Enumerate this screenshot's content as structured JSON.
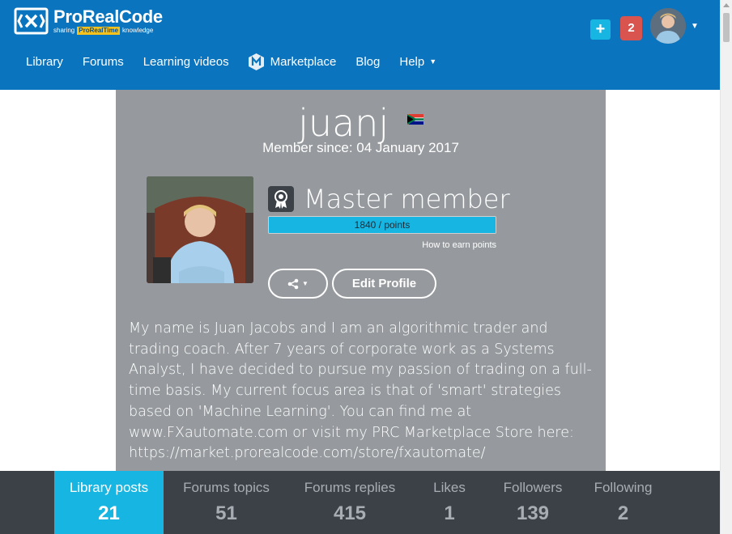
{
  "brand": {
    "name": "ProRealCode",
    "tagline_pre": "sharing",
    "tagline_highlight": "ProRealTime",
    "tagline_post": "knowledge",
    "color": "#0a74be",
    "accent": "#17b5e2"
  },
  "header": {
    "add_label": "+",
    "notifications_count": "2"
  },
  "nav": {
    "items": [
      {
        "label": "Library"
      },
      {
        "label": "Forums"
      },
      {
        "label": "Learning videos"
      },
      {
        "label": "Marketplace",
        "icon": "marketplace-m-icon"
      },
      {
        "label": "Blog"
      },
      {
        "label": "Help",
        "icon": "caret-down-icon"
      }
    ]
  },
  "profile": {
    "username": "juanj",
    "country_flag": "south-africa-flag-icon",
    "member_since": "Member since: 04 January 2017",
    "rank": "Master member",
    "points_text": "1840 / points",
    "points_progress": 1.0,
    "earn_link": "How to earn points",
    "edit_button": "Edit Profile",
    "bio": "My name is Juan Jacobs and I am an algorithmic trader and trading coach. After 7 years of corporate work as a Systems Analyst, I have decided to pursue my passion of trading on a full-time basis. My current focus area is that of 'smart' strategies based on 'Machine Learning'. You can find me at www.FXautomate.com or visit my PRC Marketplace Store here: https://market.prorealcode.com/store/fxautomate/"
  },
  "stats": [
    {
      "label": "Library posts",
      "value": "21",
      "active": true
    },
    {
      "label": "Forums topics",
      "value": "51"
    },
    {
      "label": "Forums replies",
      "value": "415"
    },
    {
      "label": "Likes",
      "value": "1"
    },
    {
      "label": "Followers",
      "value": "139"
    },
    {
      "label": "Following",
      "value": "2"
    }
  ]
}
